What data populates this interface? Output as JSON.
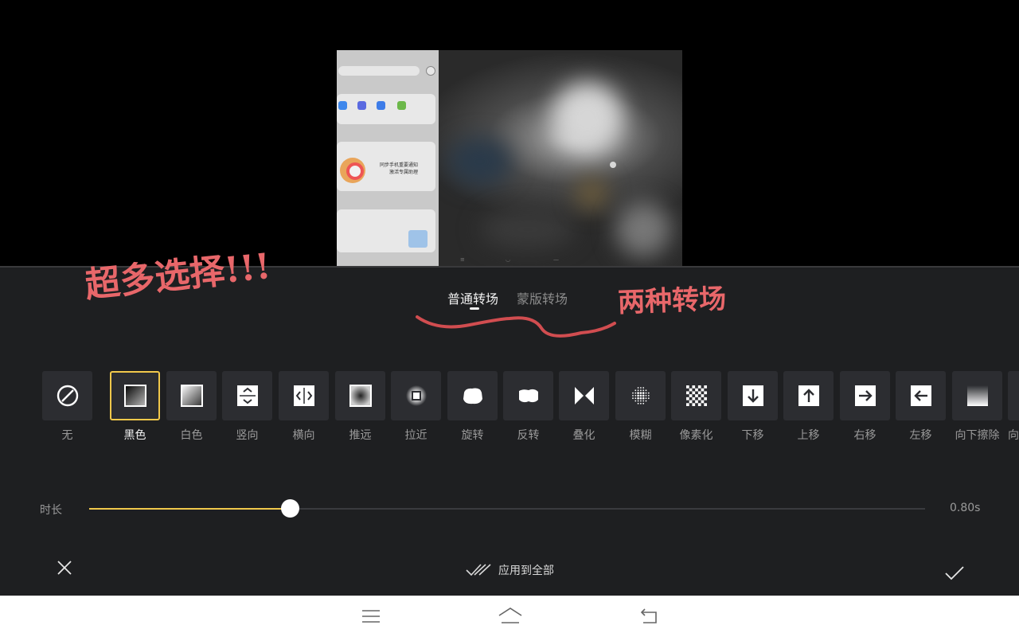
{
  "preview": {
    "phone_caption_1": "同步手机重要通知",
    "phone_caption_2": "激活专属助理"
  },
  "tabs": [
    {
      "label": "普通转场",
      "active": true
    },
    {
      "label": "蒙版转场",
      "active": false
    }
  ],
  "annotations": {
    "left": "超多选择!!!",
    "right": "两种转场"
  },
  "transitions": [
    {
      "label": "无",
      "icon": "none-icon"
    },
    {
      "label": "黑色",
      "icon": "black-fade-icon",
      "selected": true
    },
    {
      "label": "白色",
      "icon": "white-fade-icon"
    },
    {
      "label": "竖向",
      "icon": "vertical-icon"
    },
    {
      "label": "横向",
      "icon": "horizontal-icon"
    },
    {
      "label": "推远",
      "icon": "push-away-icon"
    },
    {
      "label": "拉近",
      "icon": "pull-in-icon"
    },
    {
      "label": "旋转",
      "icon": "rotate-icon"
    },
    {
      "label": "反转",
      "icon": "flip-icon"
    },
    {
      "label": "叠化",
      "icon": "dissolve-icon"
    },
    {
      "label": "模糊",
      "icon": "blur-icon"
    },
    {
      "label": "像素化",
      "icon": "pixelate-icon"
    },
    {
      "label": "下移",
      "icon": "arrow-down-icon"
    },
    {
      "label": "上移",
      "icon": "arrow-up-icon"
    },
    {
      "label": "右移",
      "icon": "arrow-right-icon"
    },
    {
      "label": "左移",
      "icon": "arrow-left-icon"
    },
    {
      "label": "向下擦除",
      "icon": "wipe-down-icon"
    },
    {
      "label": "向",
      "icon": "wipe-icon"
    }
  ],
  "duration": {
    "label": "时长",
    "value_text": "0.80s",
    "fraction": 0.24
  },
  "footer": {
    "apply_all": "应用到全部"
  },
  "colors": {
    "accent": "#f1c84b",
    "panel_bg": "#1e1f21",
    "tile_bg": "#2c2d31",
    "annotation": "#e8676a"
  }
}
